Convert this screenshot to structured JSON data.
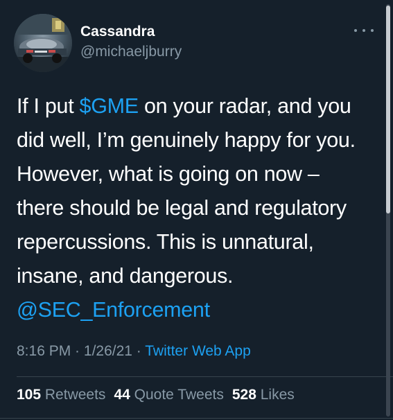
{
  "author": {
    "display_name": "Cassandra",
    "handle": "@michaeljburry"
  },
  "tweet": {
    "lines": [
      {
        "before": "If I put ",
        "link": "$GME",
        "after": " on your radar, and you"
      },
      {
        "text": "did well, I’m genuinely happy for you."
      },
      {
        "text": "However, what is going on now –"
      },
      {
        "text": "there should be legal and regulatory"
      },
      {
        "text": "repercussions. This is unnatural,"
      },
      {
        "text": "insane, and dangerous."
      },
      {
        "mention": "@SEC_Enforcement"
      }
    ]
  },
  "meta": {
    "time": "8:16 PM",
    "separator": " · ",
    "date": "1/26/21",
    "source": "Twitter Web App"
  },
  "stats": {
    "retweets_count": "105",
    "retweets_label": "Retweets",
    "quote_count": "44",
    "quote_label": "Quote Tweets",
    "likes_count": "528",
    "likes_label": "Likes"
  },
  "icons": {
    "more": "more-horizontal-icon"
  },
  "colors": {
    "background": "#15202b",
    "link": "#1da1f2",
    "secondary_text": "#8899a6",
    "primary_text": "#ffffff",
    "divider": "#38444d"
  }
}
